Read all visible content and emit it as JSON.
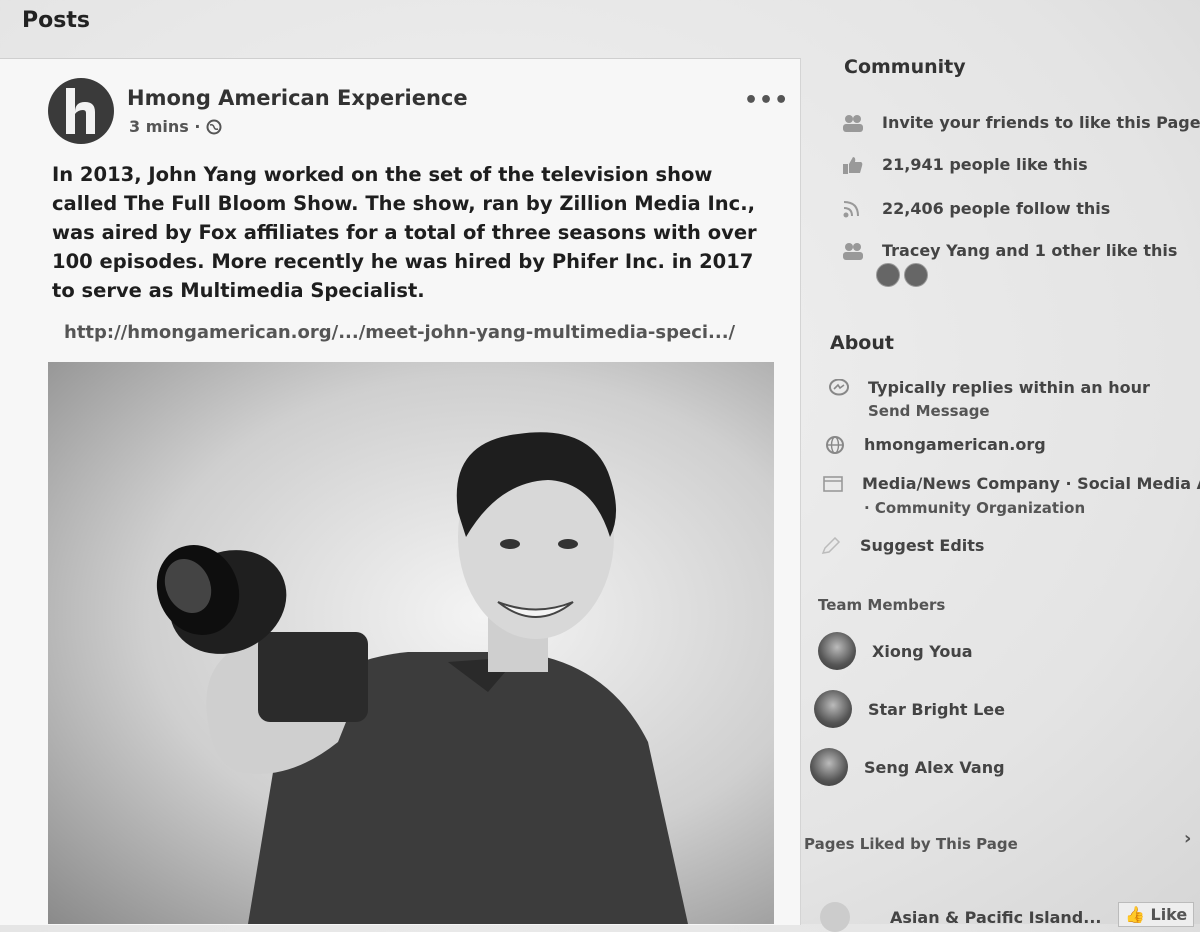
{
  "page": {
    "heading": "Posts"
  },
  "post": {
    "page_name": "Hmong American Experience",
    "time": "3 mins ·",
    "more_label": "•••",
    "text": "In 2013, John Yang worked on the set of the television show called The Full Bloom Show. The show, ran by Zillion Media Inc., was aired by Fox affiliates for a total of three seasons with over 100 episodes. More recently he was hired by Phifer Inc. in 2017 to serve as Multimedia Specialist.",
    "link": "http://hmongamerican.org/.../meet-john-yang-multimedia-speci.../"
  },
  "community": {
    "title": "Community",
    "invite": "Invite your friends to like this Page",
    "likes": "21,941 people like this",
    "follows": "22,406 people follow this",
    "friends": "Tracey Yang and 1 other like this"
  },
  "about": {
    "title": "About",
    "replies": "Typically replies within an hour",
    "send_message": "Send Message",
    "website": "hmongamerican.org",
    "category_line1": "Media/News Company · Social Media Age",
    "category_line2": "· Community Organization",
    "suggest": "Suggest Edits"
  },
  "team": {
    "title": "Team Members",
    "members": [
      "Xiong Youa",
      "Star Bright Lee",
      "Seng Alex Vang"
    ]
  },
  "pages_liked": {
    "title": "Pages Liked by This Page",
    "item": "Asian & Pacific Island...",
    "like_label": "Like"
  }
}
